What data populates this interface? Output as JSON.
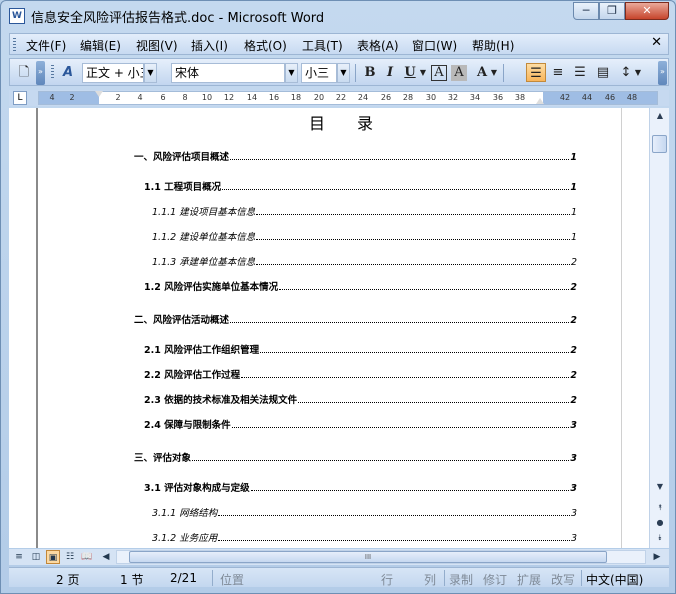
{
  "window": {
    "title": "信息安全风险评估报告格式.doc - Microsoft Word",
    "app_icon": "W",
    "minimize_glyph": "─",
    "restore_glyph": "❐",
    "close_glyph": "✕"
  },
  "menubar": {
    "items": [
      "文件(F)",
      "编辑(E)",
      "视图(V)",
      "插入(I)",
      "格式(O)",
      "工具(T)",
      "表格(A)",
      "窗口(W)",
      "帮助(H)"
    ],
    "close_glyph": "✕"
  },
  "toolbar": {
    "style_value": "正文 + 小三",
    "font_value": "宋体",
    "size_value": "小三",
    "bold": "B",
    "italic": "I",
    "underline": "U",
    "char_border": "A",
    "char_shading": "A",
    "font_color": "A"
  },
  "ruler": {
    "ticks": [
      "4",
      "2",
      "2",
      "4",
      "6",
      "8",
      "10",
      "12",
      "14",
      "16",
      "18",
      "20",
      "22",
      "24",
      "26",
      "28",
      "30",
      "32",
      "34",
      "36",
      "38",
      "42",
      "44",
      "46",
      "48"
    ],
    "tab_selector": "L"
  },
  "document": {
    "toc_title": "目　　录",
    "entries": [
      {
        "level": 1,
        "text": "一、风险评估项目概述",
        "page": "1"
      },
      {
        "level": 2,
        "text": "1.1  工程项目概况",
        "page": "1"
      },
      {
        "level": 3,
        "text": "1.1.1   建设项目基本信息",
        "page": "1"
      },
      {
        "level": 3,
        "text": "1.1.2   建设单位基本信息",
        "page": "1"
      },
      {
        "level": 3,
        "text": "1.1.3  承建单位基本信息",
        "page": "2"
      },
      {
        "level": 2,
        "text": "1.2  风险评估实施单位基本情况",
        "page": "2"
      },
      {
        "level": 1,
        "text": "二、风险评估活动概述",
        "page": "2"
      },
      {
        "level": 2,
        "text": "2.1  风险评估工作组织管理",
        "page": "2"
      },
      {
        "level": 2,
        "text": "2.2  风险评估工作过程",
        "page": "2"
      },
      {
        "level": 2,
        "text": "2.3  依据的技术标准及相关法规文件",
        "page": "2"
      },
      {
        "level": 2,
        "text": "2.4  保障与限制条件",
        "page": "3"
      },
      {
        "level": 1,
        "text": "三、评估对象",
        "page": "3"
      },
      {
        "level": 2,
        "text": "3.1  评估对象构成与定级",
        "page": "3"
      },
      {
        "level": 3,
        "text": "3.1.1   网络结构",
        "page": "3"
      },
      {
        "level": 3,
        "text": "3.1.2   业务应用",
        "page": "3"
      }
    ]
  },
  "statusbar": {
    "page": "2 页",
    "section": "1 节",
    "page_of": "2/21",
    "position": "位置",
    "line": "行",
    "column": "列",
    "rec": "录制",
    "trk": "修订",
    "ext": "扩展",
    "ovr": "改写",
    "language": "中文(中国)"
  }
}
